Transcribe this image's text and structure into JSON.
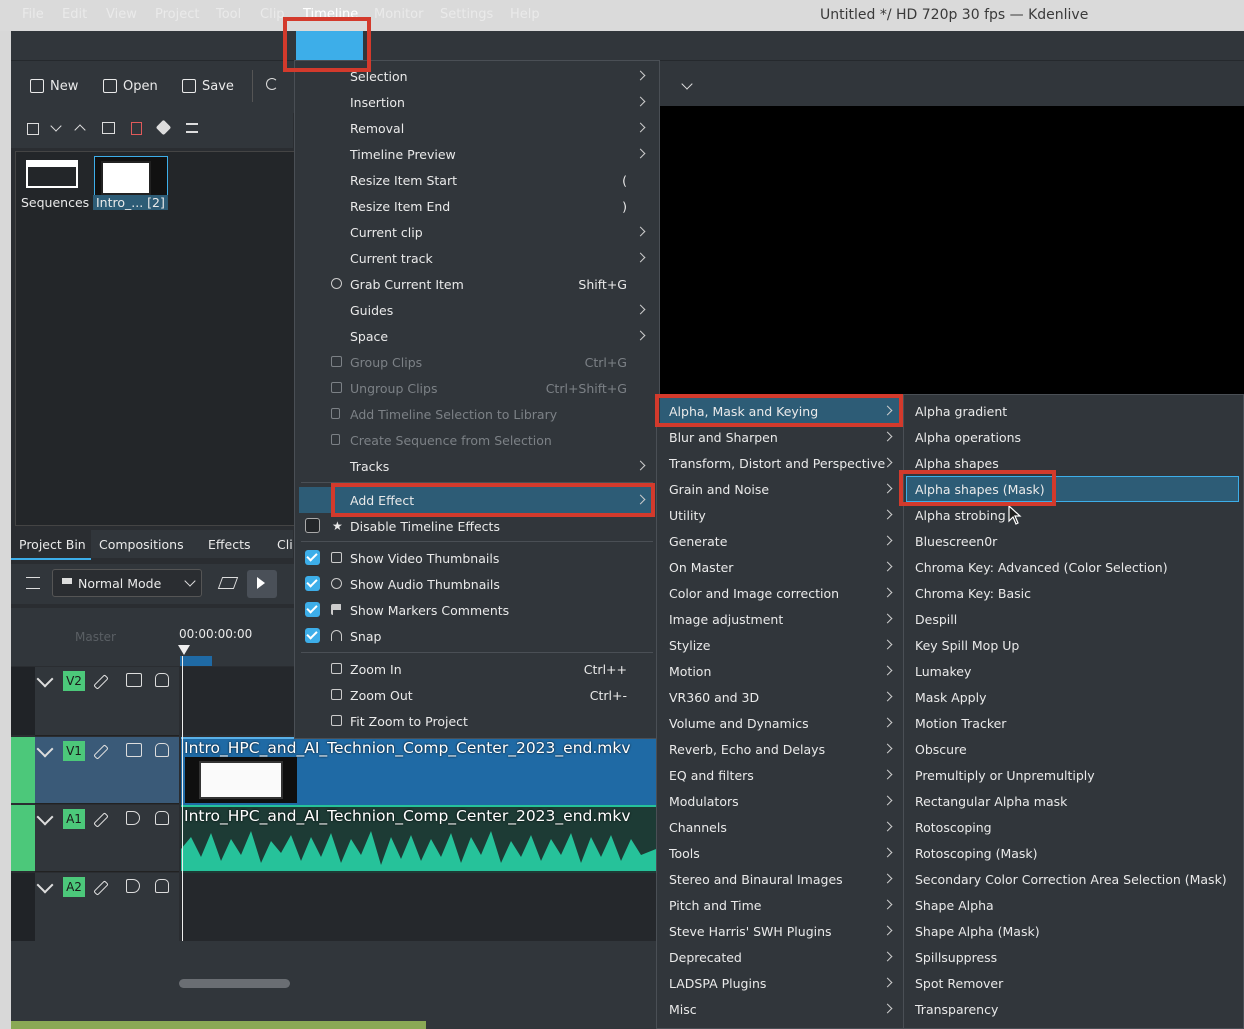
{
  "window": {
    "title": "Untitled */ HD 720p 30 fps — Kdenlive"
  },
  "menubar": [
    "File",
    "Edit",
    "View",
    "Project",
    "Tool",
    "Clip",
    "Timeline",
    "Monitor",
    "Settings",
    "Help"
  ],
  "toolbar": {
    "new": "New",
    "open": "Open",
    "save": "Save"
  },
  "bin": {
    "sequences_label": "Sequences",
    "clip_label": "Intro_... [2]"
  },
  "tabs": [
    "Project Bin",
    "Compositions",
    "Effects",
    "Cli"
  ],
  "timeline": {
    "mode": "Normal Mode",
    "timecode": "00:00:00:00",
    "master_label": "Master",
    "tracks": [
      {
        "tag": "V2"
      },
      {
        "tag": "V1",
        "clip": "Intro_HPC_and_AI_Technion_Comp_Center_2023_end.mkv"
      },
      {
        "tag": "A1",
        "clip": "Intro_HPC_and_AI_Technion_Comp_Center_2023_end.mkv"
      },
      {
        "tag": "A2"
      }
    ]
  },
  "timeline_menu": {
    "items": [
      {
        "label": "Selection",
        "submenu": true
      },
      {
        "label": "Insertion",
        "submenu": true
      },
      {
        "label": "Removal",
        "submenu": true
      },
      {
        "label": "Timeline Preview",
        "submenu": true
      },
      {
        "label": "Resize Item Start",
        "shortcut": "("
      },
      {
        "label": "Resize Item End",
        "shortcut": ")"
      },
      {
        "label": "Current clip",
        "submenu": true
      },
      {
        "label": "Current track",
        "submenu": true
      },
      {
        "label": "Grab Current Item",
        "shortcut": "Shift+G",
        "icon": "grab-icon"
      },
      {
        "label": "Guides",
        "submenu": true
      },
      {
        "label": "Space",
        "submenu": true
      },
      {
        "label": "Group Clips",
        "shortcut": "Ctrl+G",
        "disabled": true,
        "icon": "group-icon"
      },
      {
        "label": "Ungroup Clips",
        "shortcut": "Ctrl+Shift+G",
        "disabled": true,
        "icon": "ungroup-icon"
      },
      {
        "label": "Add Timeline Selection to Library",
        "disabled": true,
        "icon": "library-icon"
      },
      {
        "label": "Create Sequence from Selection",
        "disabled": true,
        "icon": "sequence-icon"
      },
      {
        "label": "Tracks",
        "submenu": true
      }
    ],
    "add_effect": "Add Effect",
    "checks": [
      {
        "label": "Disable Timeline Effects",
        "checked": false
      },
      {
        "label": "Show Video Thumbnails",
        "checked": true
      },
      {
        "label": "Show Audio Thumbnails",
        "checked": true
      },
      {
        "label": "Show Markers Comments",
        "checked": true
      },
      {
        "label": "Snap",
        "checked": true
      }
    ],
    "zoom": [
      {
        "label": "Zoom In",
        "shortcut": "Ctrl++"
      },
      {
        "label": "Zoom Out",
        "shortcut": "Ctrl+-"
      },
      {
        "label": "Fit Zoom to Project"
      }
    ]
  },
  "effect_categories": [
    "Alpha, Mask and Keying",
    "Blur and Sharpen",
    "Transform, Distort and Perspective",
    "Grain and Noise",
    "Utility",
    "Generate",
    "On Master",
    "Color and Image correction",
    "Image adjustment",
    "Stylize",
    "Motion",
    "VR360 and 3D",
    "Volume and Dynamics",
    "Reverb, Echo and Delays",
    "EQ and filters",
    "Modulators",
    "Channels",
    "Tools",
    "Stereo and Binaural Images",
    "Pitch and Time",
    "Steve Harris' SWH Plugins",
    "Deprecated",
    "LADSPA Plugins",
    "Misc"
  ],
  "alpha_effects": [
    "Alpha gradient",
    "Alpha operations",
    "Alpha shapes",
    "Alpha shapes (Mask)",
    "Alpha strobing",
    "Bluescreen0r",
    "Chroma Key: Advanced (Color Selection)",
    "Chroma Key: Basic",
    "Despill",
    "Key Spill Mop Up",
    "Lumakey",
    "Mask Apply",
    "Motion Tracker",
    "Obscure",
    "Premultiply or Unpremultiply",
    "Rectangular Alpha mask",
    "Rotoscoping",
    "Rotoscoping (Mask)",
    "Secondary Color Correction Area Selection (Mask)",
    "Shape Alpha",
    "Shape Alpha (Mask)",
    "Spillsuppress",
    "Spot Remover",
    "Transparency"
  ],
  "colors": {
    "accent": "#3daee9",
    "highlight": "#2d5c76",
    "annotation": "#d33a2c",
    "track_tag": "#4cc87a",
    "audio_wave": "#26c29a",
    "video_clip": "#1f6aa5"
  }
}
